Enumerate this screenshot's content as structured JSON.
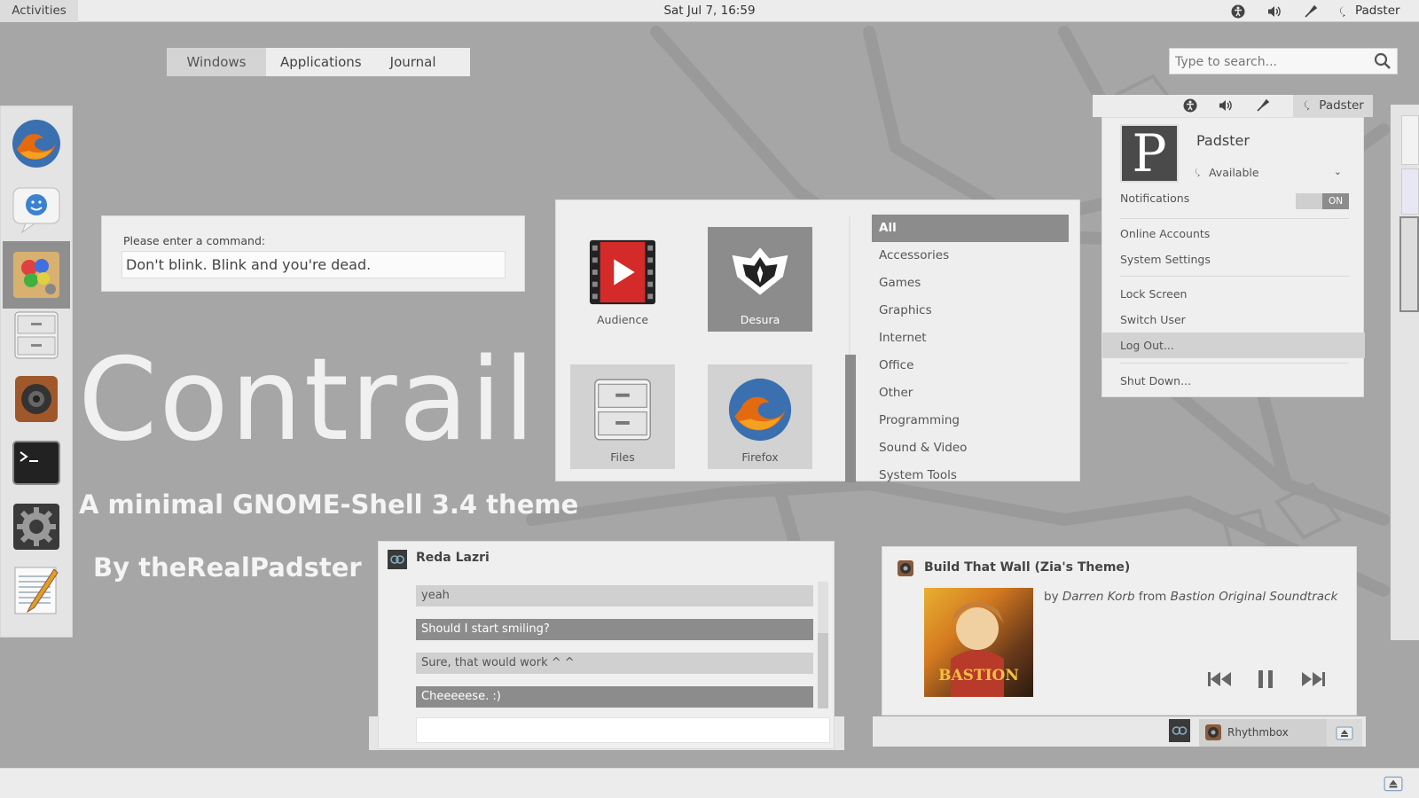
{
  "topbar": {
    "activities": "Activities",
    "clock": "Sat Jul  7, 16:59",
    "user": "Padster",
    "icons": [
      "accessibility-icon",
      "volume-icon",
      "power-icon",
      "chat-status-icon"
    ]
  },
  "overview": {
    "tabs": [
      {
        "label": "Windows",
        "active": true
      },
      {
        "label": "Applications",
        "active": false
      },
      {
        "label": "Journal",
        "active": false
      }
    ],
    "search_placeholder": "Type to search..."
  },
  "dock": {
    "items": [
      "firefox-icon",
      "empathy-icon",
      "paint-icon",
      "files-icon",
      "speaker-icon",
      "terminal-icon",
      "settings-icon",
      "text-editor-icon"
    ]
  },
  "command_dialog": {
    "label": "Please enter a command:",
    "value": "Don't blink. Blink and you're dead. "
  },
  "branding": {
    "title": "Contrail",
    "tagline": "A minimal GNOME-Shell 3.4 theme",
    "byline": "By theRealPadster"
  },
  "app_grid": {
    "apps": [
      {
        "label": "Audience",
        "state": "normal"
      },
      {
        "label": "Desura",
        "state": "selected"
      },
      {
        "label": "Files",
        "state": "hover"
      },
      {
        "label": "Firefox",
        "state": "hover"
      }
    ],
    "categories": [
      "All",
      "Accessories",
      "Games",
      "Graphics",
      "Internet",
      "Office",
      "Other",
      "Programming",
      "Sound & Video",
      "System Tools"
    ],
    "active_category": "All"
  },
  "user_menu": {
    "button": "Padster",
    "name": "Padster",
    "avatar_letter": "P",
    "status": "Available",
    "notifications_label": "Notifications",
    "notifications_state": "ON",
    "items": [
      "Online Accounts",
      "System Settings",
      "Lock Screen",
      "Switch User",
      "Log Out...",
      "Shut Down..."
    ],
    "active_item": "Log Out..."
  },
  "chat": {
    "contact": "Reda Lazri",
    "messages": [
      {
        "text": "yeah",
        "dir": "in"
      },
      {
        "text": "Should I start smiling?",
        "dir": "out"
      },
      {
        "text": "Sure, that would work ^ ^",
        "dir": "in"
      },
      {
        "text": "Cheeeeese. :)",
        "dir": "out"
      }
    ],
    "input": ""
  },
  "music": {
    "title": "Build That Wall (Zia's Theme)",
    "by_prefix": "by",
    "artist": "Darren Korb",
    "from_word": "from",
    "album": "Bastion Original Soundtrack",
    "cover_text": "BASTION",
    "controls": [
      "previous-icon",
      "pause-icon",
      "next-icon"
    ]
  },
  "tray": {
    "rhythmbox": "Rhythmbox"
  },
  "colors": {
    "background": "#a6a6a6",
    "accent": "#8c8c8c",
    "panel": "#efefef"
  }
}
